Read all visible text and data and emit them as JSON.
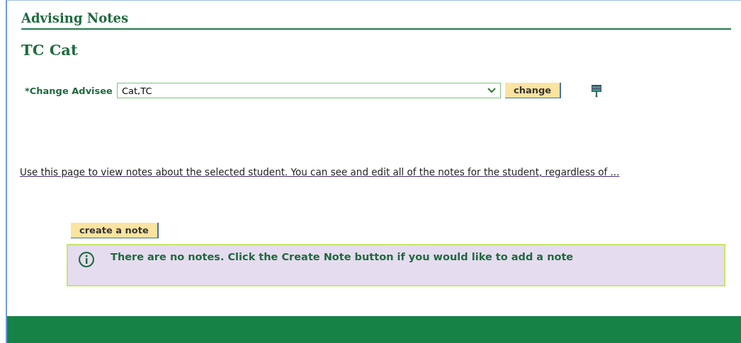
{
  "page": {
    "title": "Advising Notes",
    "student_name": "TC Cat"
  },
  "advisee": {
    "label": "*Change Advisee",
    "value": "Cat,TC",
    "button": "change"
  },
  "description": "Use this page to view notes about the selected student. You can see and edit all of the notes for the student, regardless of ...",
  "create_button": "create a note",
  "message": {
    "text": "There are no notes. Click the Create Note button if you would like to add a note"
  }
}
